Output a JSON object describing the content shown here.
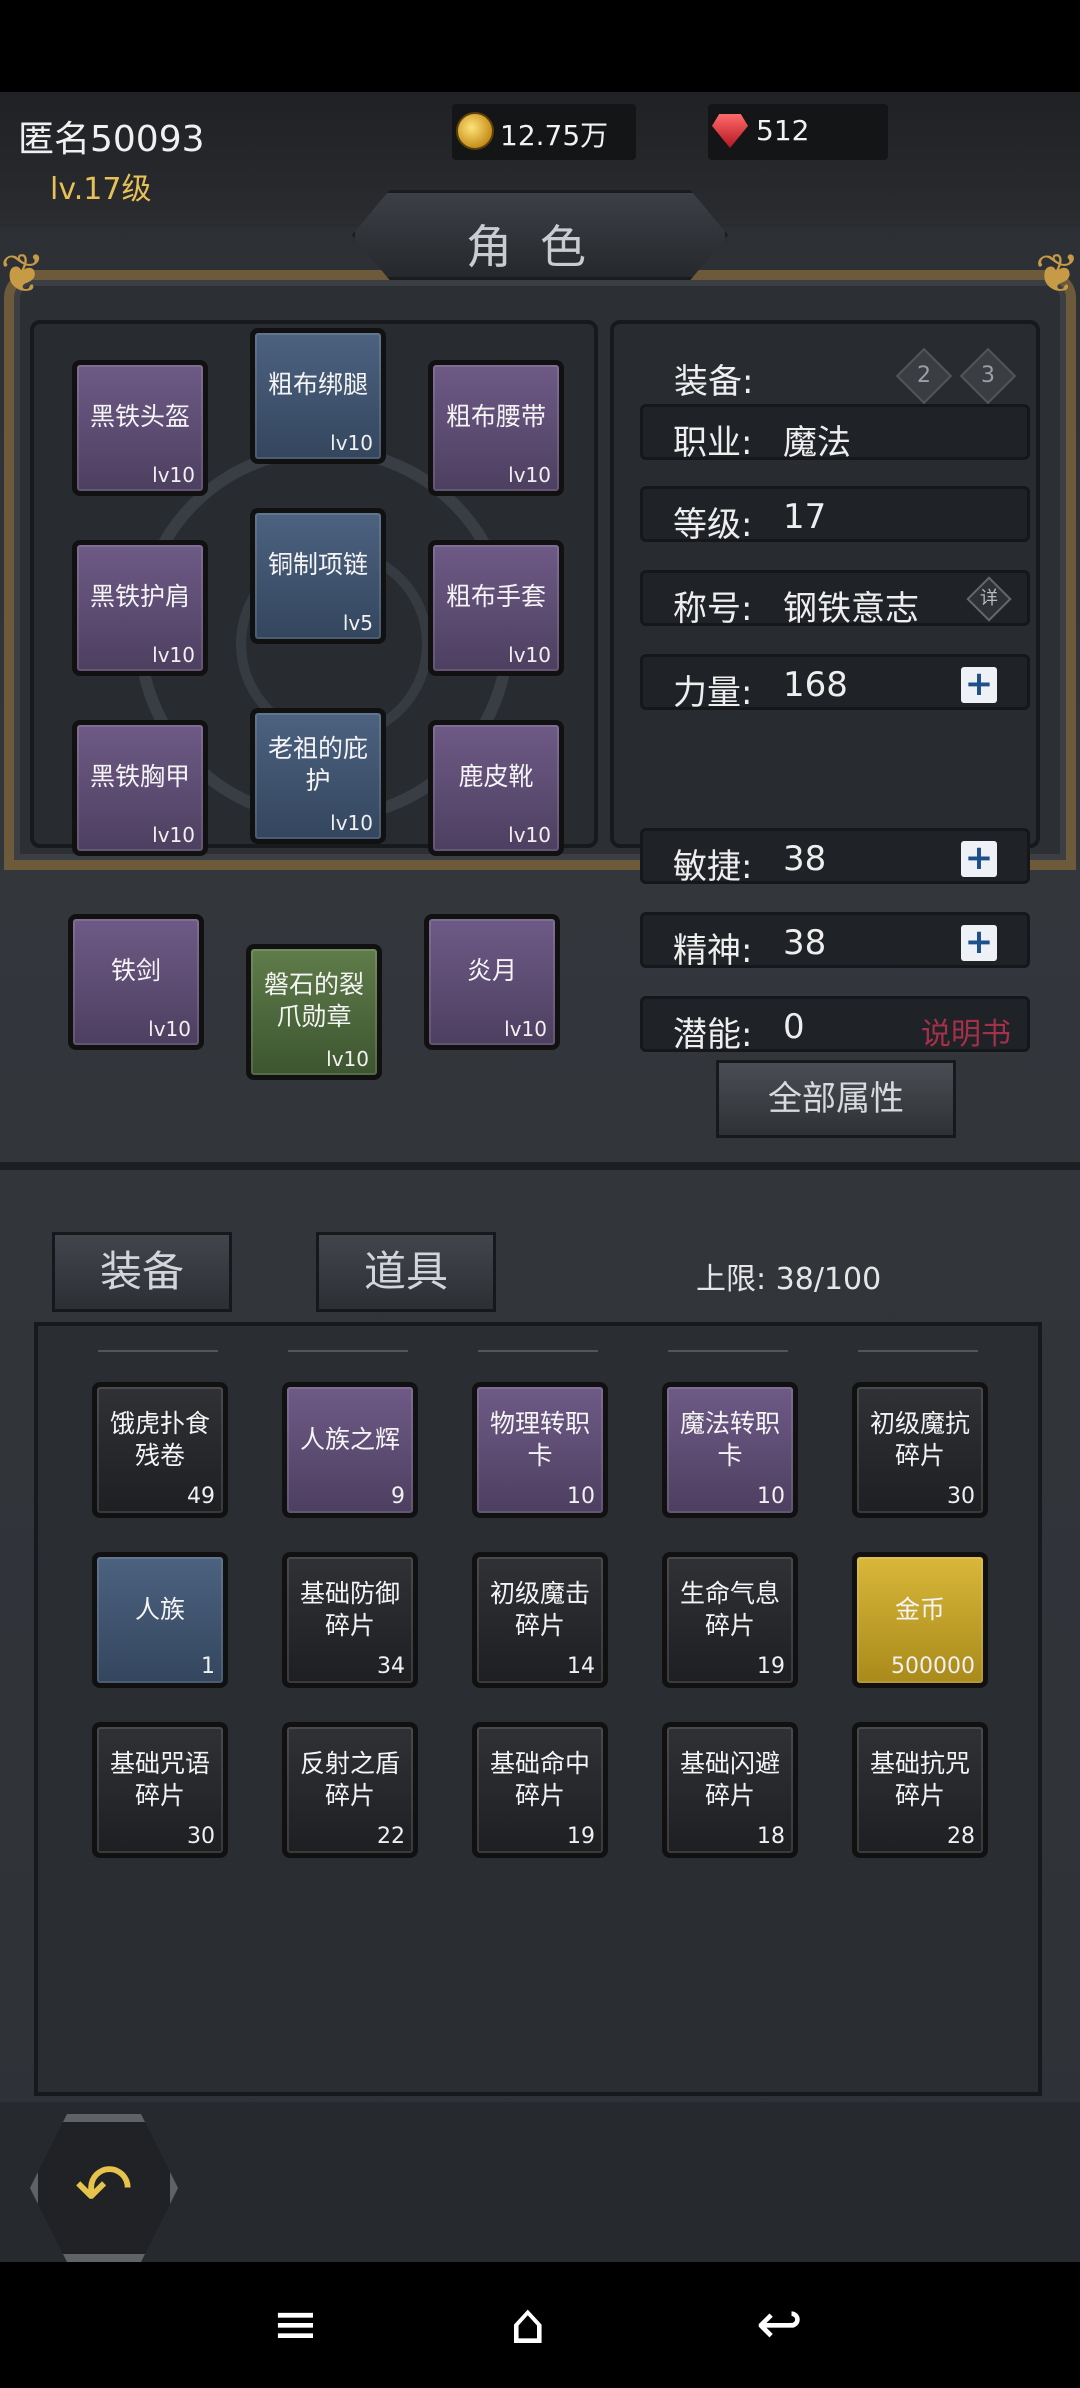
{
  "header": {
    "player_name": "匿名50093",
    "player_level": "lv.17级",
    "gold": "12.75万",
    "gems": "512",
    "screen_title": "角色"
  },
  "equipment": {
    "slots": [
      {
        "name": "黑铁头盔",
        "level": "lv10",
        "quality": "purple"
      },
      {
        "name": "粗布绑腿",
        "level": "lv10",
        "quality": "blue"
      },
      {
        "name": "粗布腰带",
        "level": "lv10",
        "quality": "purple"
      },
      {
        "name": "黑铁护肩",
        "level": "lv10",
        "quality": "purple"
      },
      {
        "name": "铜制项链",
        "level": "lv5",
        "quality": "blue"
      },
      {
        "name": "粗布手套",
        "level": "lv10",
        "quality": "purple"
      },
      {
        "name": "黑铁胸甲",
        "level": "lv10",
        "quality": "purple"
      },
      {
        "name": "老祖的庇护",
        "level": "lv10",
        "quality": "blue"
      },
      {
        "name": "鹿皮靴",
        "level": "lv10",
        "quality": "purple"
      },
      {
        "name": "铁剑",
        "level": "lv10",
        "quality": "purple"
      },
      {
        "name": "磐石的裂爪勋章",
        "level": "lv10",
        "quality": "green"
      },
      {
        "name": "炎月",
        "level": "lv10",
        "quality": "purple"
      }
    ]
  },
  "stats": {
    "equip_label": "装备:",
    "loadout_2": "2",
    "loadout_3": "3",
    "class_label": "职业:",
    "class_value": "魔法",
    "level_label": "等级:",
    "level_value": "17",
    "title_label": "称号:",
    "title_value": "钢铁意志",
    "title_detail": "详",
    "str_label": "力量:",
    "str_value": "168",
    "agi_label": "敏捷:",
    "agi_value": "38",
    "spi_label": "精神:",
    "spi_value": "38",
    "pot_label": "潜能:",
    "pot_value": "0",
    "manual_link": "说明书",
    "all_attributes": "全部属性",
    "plus": "+"
  },
  "inventory": {
    "tab_equipment": "装备",
    "tab_items": "道具",
    "capacity": "上限: 38/100",
    "items": [
      {
        "name": "饿虎扑食残卷",
        "count": "49",
        "quality": "gray"
      },
      {
        "name": "人族之辉",
        "count": "9",
        "quality": "purple"
      },
      {
        "name": "物理转职卡",
        "count": "10",
        "quality": "purple"
      },
      {
        "name": "魔法转职卡",
        "count": "10",
        "quality": "purple"
      },
      {
        "name": "初级魔抗碎片",
        "count": "30",
        "quality": "gray"
      },
      {
        "name": "人族",
        "count": "1",
        "quality": "blue"
      },
      {
        "name": "基础防御碎片",
        "count": "34",
        "quality": "gray"
      },
      {
        "name": "初级魔击碎片",
        "count": "14",
        "quality": "gray"
      },
      {
        "name": "生命气息碎片",
        "count": "19",
        "quality": "gray"
      },
      {
        "name": "金币",
        "count": "500000",
        "quality": "gold"
      },
      {
        "name": "基础咒语碎片",
        "count": "30",
        "quality": "gray"
      },
      {
        "name": "反射之盾碎片",
        "count": "22",
        "quality": "gray"
      },
      {
        "name": "基础命中碎片",
        "count": "19",
        "quality": "gray"
      },
      {
        "name": "基础闪避碎片",
        "count": "18",
        "quality": "gray"
      },
      {
        "name": "基础抗咒碎片",
        "count": "28",
        "quality": "gray"
      }
    ]
  },
  "footer": {
    "back_icon": "back-arrow-icon"
  },
  "sysnav": {
    "menu": "≡",
    "home": "⌂",
    "back": "↩"
  }
}
